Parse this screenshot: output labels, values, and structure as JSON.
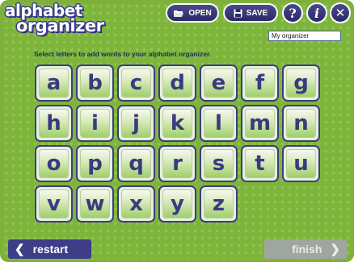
{
  "header": {
    "logo_line1": "alphabet",
    "logo_line2": "organizer",
    "open_label": "OPEN",
    "save_label": "SAVE",
    "help_label": "?",
    "info_label": "i",
    "close_label": "✕"
  },
  "title_field": {
    "value": "My organizer"
  },
  "instruction": "Select letters to add words to your alphabet organizer.",
  "letters": [
    "a",
    "b",
    "c",
    "d",
    "e",
    "f",
    "g",
    "h",
    "i",
    "j",
    "k",
    "l",
    "m",
    "n",
    "o",
    "p",
    "q",
    "r",
    "s",
    "t",
    "u",
    "v",
    "w",
    "x",
    "y",
    "z"
  ],
  "footer": {
    "restart_label": "restart",
    "finish_label": "finish",
    "finish_enabled": false
  },
  "icons": {
    "open": "folder-open-icon",
    "save": "floppy-disk-icon",
    "restart": "chevron-left-icon",
    "finish": "chevron-right-icon"
  },
  "colors": {
    "background_green": "#7db53a",
    "navy": "#3d3d88",
    "disabled_gray": "#9fa6a0"
  }
}
